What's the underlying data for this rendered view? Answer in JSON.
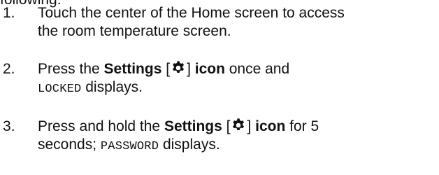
{
  "intro_fragment": "following:",
  "steps": [
    {
      "number": "1.",
      "line1": "Touch the center of the Home screen to access",
      "line2": "the room temperature screen."
    },
    {
      "number": "2.",
      "press": "Press the ",
      "settings_label": "Settings",
      "bracket_open": " [",
      "bracket_close": "] ",
      "icon_label": "icon",
      "after_icon": " once and",
      "status_word": "LOCKED",
      "status_suffix": " displays."
    },
    {
      "number": "3.",
      "press": "Press and hold the ",
      "settings_label": "Settings",
      "bracket_open": " [",
      "bracket_close": "] ",
      "icon_label": "icon",
      "after_icon": " for 5",
      "line2_prefix": "seconds; ",
      "status_word": "PASSWORD",
      "status_suffix": " displays."
    }
  ],
  "icons": {
    "settings": "gear-icon"
  }
}
